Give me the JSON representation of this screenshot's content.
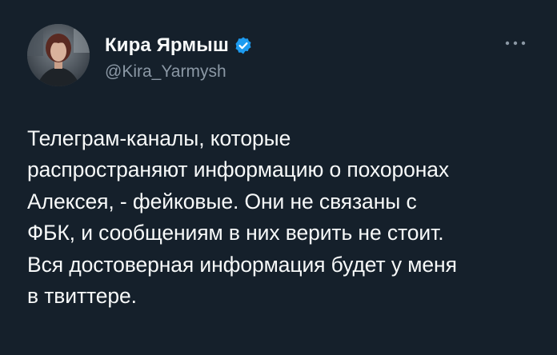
{
  "author": {
    "display_name": "Кира Ярмыш",
    "handle": "@Kira_Yarmysh",
    "verified": true,
    "verified_color": "#1d9bf0"
  },
  "menu": {
    "more_icon": "more-horizontal-icon",
    "more_label": "···"
  },
  "tweet": {
    "lines": [
      "Телеграм-каналы, которые",
      "распространяют информацию о похоронах",
      "Алексея, - фейковые. Они не связаны с",
      "ФБК, и сообщениям в них верить не стоит.",
      "Вся достоверная информация будет у меня",
      "в твиттере."
    ]
  },
  "colors": {
    "background": "#15202b",
    "text_primary": "#f7f9f9",
    "text_secondary": "#8b98a5"
  }
}
